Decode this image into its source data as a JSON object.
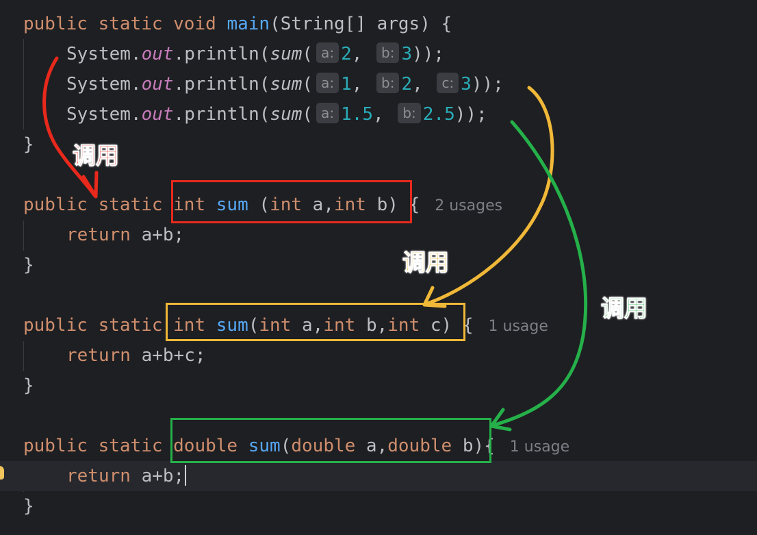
{
  "code": {
    "main_decl": {
      "kw_public": "public",
      "kw_static": "static",
      "kw_void": "void",
      "fn_name": "main",
      "params": "(String[] args) {"
    },
    "call1": {
      "prefix": "System.",
      "field": "out",
      "method": ".println(",
      "fn": "sum",
      "open": "(",
      "hint_a": "a:",
      "val_a": "2",
      "sep1": ", ",
      "hint_b": "b:",
      "val_b": "3",
      "close": "));"
    },
    "call2": {
      "prefix": "System.",
      "field": "out",
      "method": ".println(",
      "fn": "sum",
      "open": "(",
      "hint_a": "a:",
      "val_a": "1",
      "sep1": ", ",
      "hint_b": "b:",
      "val_b": "2",
      "sep2": ", ",
      "hint_c": "c:",
      "val_c": "3",
      "close": "));"
    },
    "call3": {
      "prefix": "System.",
      "field": "out",
      "method": ".println(",
      "fn": "sum",
      "open": "(",
      "hint_a": "a:",
      "val_a": "1.5",
      "sep1": ", ",
      "hint_b": "b:",
      "val_b": "2.5",
      "close": "));"
    },
    "brace_close": "}",
    "sum1": {
      "kw_public": "public",
      "kw_static": "static",
      "kw_type": "int",
      "fn_name": "sum",
      "p_open": " (",
      "p_t1": "int",
      "p_a": " a,",
      "p_t2": "int",
      "p_b": " b)",
      "brace": " {",
      "usages": "2 usages",
      "ret_kw": "return",
      "ret_expr": " a+b;"
    },
    "sum2": {
      "kw_public": "public",
      "kw_static": "static",
      "kw_type": "int",
      "fn_name": "sum",
      "p_open": "(",
      "p_t1": "int",
      "p_a": " a,",
      "p_t2": "int",
      "p_b": " b,",
      "p_t3": "int",
      "p_c": " c)",
      "brace": " {",
      "usages": "1 usage",
      "ret_kw": "return",
      "ret_expr": " a+b+c;"
    },
    "sum3": {
      "kw_public": "public",
      "kw_static": "static",
      "kw_type": "double",
      "fn_name": "sum",
      "p_open": "(",
      "p_t1": "double",
      "p_a": " a,",
      "p_t2": "double",
      "p_b": " b)",
      "brace": "{",
      "usages": "1 usage",
      "ret_kw": "return",
      "ret_expr": " a+b;"
    }
  },
  "annotations": {
    "red_label": "调用",
    "yellow_label": "调用",
    "green_label": "调用",
    "red_color": "#e8291c",
    "yellow_color": "#f0b838",
    "green_color": "#25b04a"
  },
  "theme": {
    "background": "#1e1f22",
    "keyword": "#cf8e6d",
    "function": "#56a8f5",
    "number": "#2aacb8",
    "field": "#c77dbb"
  }
}
